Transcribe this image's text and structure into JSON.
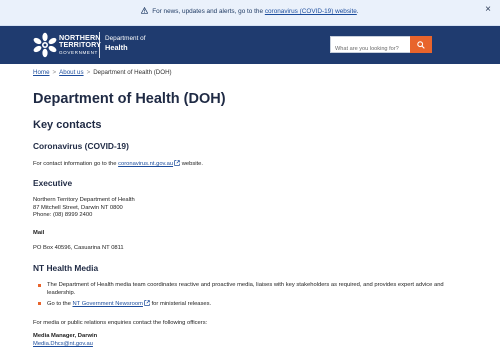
{
  "alert": {
    "prefix": "For news, updates and alerts, go to the",
    "link": "coronavirus (COVID-19) website",
    "suffix": ".",
    "close": "×"
  },
  "header": {
    "logo_line1": "NORTHERN",
    "logo_line2": "TERRITORY",
    "logo_line3": "GOVERNMENT",
    "dept_line1": "Department of",
    "dept_line2": "Health",
    "search_placeholder": "What are you looking for?"
  },
  "breadcrumb": {
    "home": "Home",
    "about": "About us",
    "current": "Department of Health (DOH)",
    "separator": ">"
  },
  "page": {
    "title": "Department of Health (DOH)",
    "key_contacts": "Key contacts",
    "coronavirus_heading": "Coronavirus (COVID-19)",
    "coronavirus_text_prefix": "For contact information go to the",
    "coronavirus_link": "coronavirus.nt.gov.au",
    "coronavirus_text_suffix": "website.",
    "executive_heading": "Executive",
    "exec_line1": "Northern Territory Department of Health",
    "exec_line2": "87 Mitchell Street, Darwin NT 0800",
    "exec_line3": "Phone: (08) 8999 2400",
    "mail_label": "Mail",
    "mail_text": "PO Box 40596, Casuarina NT 0811",
    "media_heading": "NT Health Media",
    "bullet1": "The Department of Health media team coordinates reactive and proactive media, liaises with key stakeholders as required, and provides expert advice and leadership.",
    "bullet2_prefix": "Go to the",
    "bullet2_link": "NT Government Newsroom",
    "bullet2_suffix": "for ministerial releases.",
    "media_enquiries": "For media or public relations enquiries contact the following officers:",
    "media_manager": "Media Manager, Darwin",
    "media_email": "Media.Dhcs@nt.gov.au"
  },
  "colors": {
    "header_bg": "#1f3b6f",
    "alert_bg": "#eaf1fb",
    "accent_orange": "#e8642c",
    "link_blue": "#1b4c9c"
  }
}
